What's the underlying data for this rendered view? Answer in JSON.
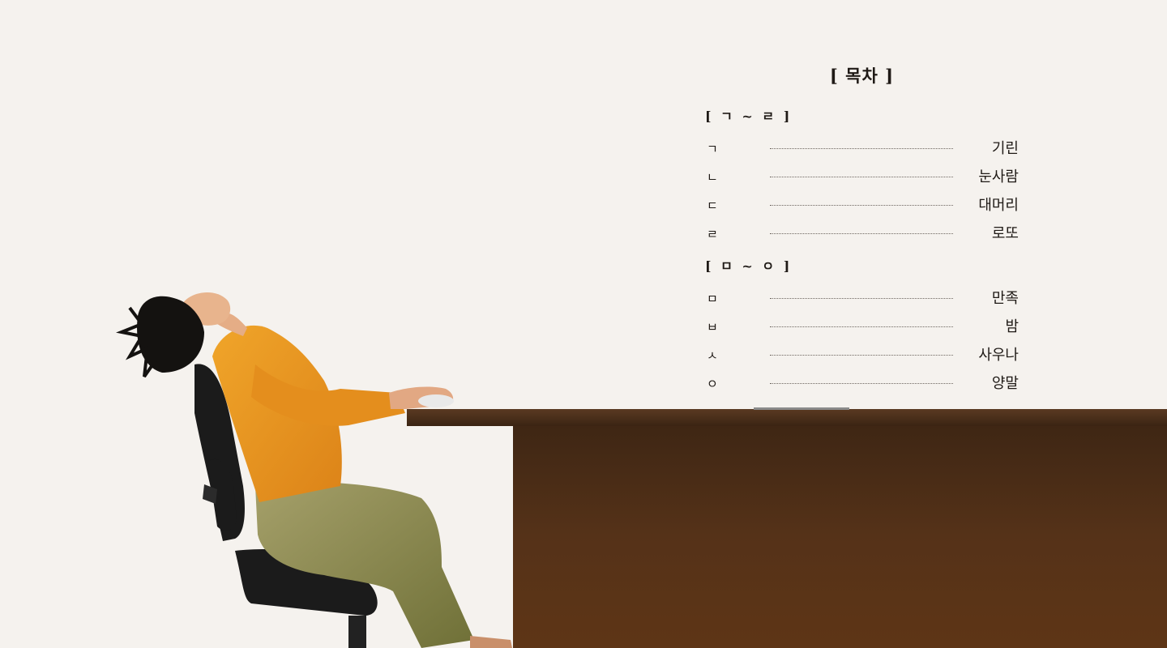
{
  "toc": {
    "title": "[ 목차 ]",
    "sections": [
      {
        "heading": "[ ㄱ ~ ㄹ ]",
        "items": [
          {
            "index": "ㄱ",
            "title": "기린"
          },
          {
            "index": "ㄴ",
            "title": "눈사람"
          },
          {
            "index": "ㄷ",
            "title": "대머리"
          },
          {
            "index": "ㄹ",
            "title": "로또"
          }
        ]
      },
      {
        "heading": "[ ㅁ ~ ㅇ ]",
        "items": [
          {
            "index": "ㅁ",
            "title": "만족"
          },
          {
            "index": "ㅂ",
            "title": "밤"
          },
          {
            "index": "ㅅ",
            "title": "사우나"
          },
          {
            "index": "ㅇ",
            "title": "양말"
          }
        ]
      }
    ]
  },
  "illustration": {
    "subject": "person-leaning-back-in-office-chair-at-desk",
    "colors": {
      "background": "#f5f2ee",
      "desk": "#4a2d17",
      "sweater": "#e8951f",
      "pants": "#8b8a4a",
      "hair": "#141210",
      "chair": "#1b1b1b"
    }
  }
}
